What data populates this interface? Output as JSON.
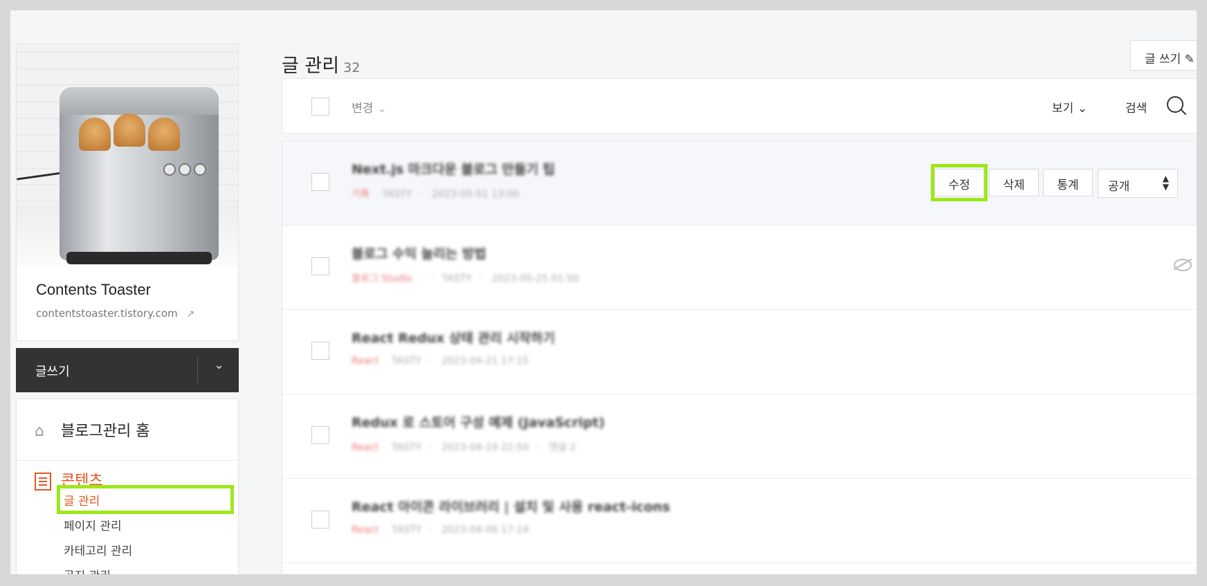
{
  "sidebar": {
    "blog_name": "Contents Toaster",
    "blog_url": "contentstoaster.tistory.com",
    "write_button": "글쓰기",
    "menu": {
      "home": "블로그관리 홈",
      "content": "콘텐츠",
      "sub_items": [
        "글 관리",
        "페이지 관리",
        "카테고리 관리",
        "공지 관리"
      ]
    }
  },
  "main": {
    "title": "글 관리",
    "post_count": "32",
    "new_post_button": "글 쓰기",
    "toolbar": {
      "change": "변경",
      "view": "보기",
      "search": "검색"
    },
    "row_actions": {
      "edit": "수정",
      "delete": "삭제",
      "stats": "통계",
      "visibility": "공개"
    },
    "posts": [
      {
        "title": "Next.js 마크다운 블로그 만들기 팁",
        "category": "기록",
        "author": "TASTY",
        "date": "2023-05-01 13:00"
      },
      {
        "title": "블로그 수익 늘리는 방법",
        "category": "블로그 Studio",
        "author": "TASTY",
        "date": "2023-05-25 01:50"
      },
      {
        "title": "React Redux 상태 관리 시작하기",
        "category": "React",
        "author": "TASTY",
        "date": "2023-04-21 17:15"
      },
      {
        "title": "Redux 로 스토어 구성 예제 (JavaScript)",
        "category": "React",
        "author": "TASTY",
        "date": "2023-04-19 22:50",
        "extra": "댓글 2"
      },
      {
        "title": "React 아이콘 라이브러리 | 설치 및 사용 react-icons",
        "category": "React",
        "author": "TASTY",
        "date": "2023-04-06 17:14"
      }
    ]
  },
  "colors": {
    "accent": "#eb531f",
    "highlight": "#9de81a",
    "dark_button": "#333333"
  }
}
